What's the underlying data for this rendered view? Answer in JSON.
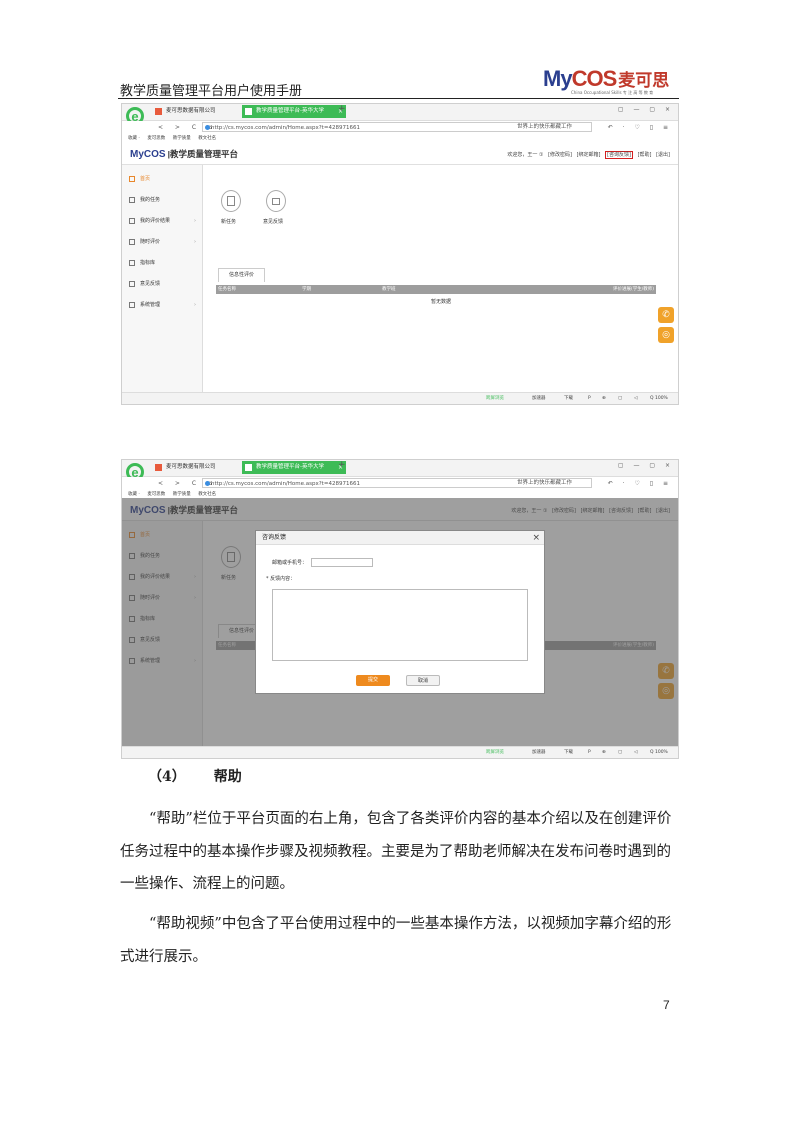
{
  "header": {
    "doc_title": "教学质量管理平台用户使用手册",
    "logo_brand_a": "My",
    "logo_brand_b": "COS",
    "logo_cn": "麦可思",
    "logo_sub": "China Occupational Skills  专 注 高 等 教 育"
  },
  "browser": {
    "tab1_label": "麦可思数据有限公司",
    "tab2_label": "教学质量管理平台-英华大学",
    "close_glyph": "×",
    "plus_glyph": "+",
    "window_controls": "▢ — ▢ ×",
    "nav_buttons": "< > C ⌂",
    "url": "http://cs.mycos.com/admin/Home.aspx?t=428971661",
    "search_text": "世界上的快乐都藏工作",
    "addr_controls": "↶ · ♡ ▯ ≡",
    "bookmarks": [
      "收藏 ·",
      "麦可思数",
      "教学质量",
      "教文社名"
    ],
    "ie_letter": "e"
  },
  "app": {
    "logo_brand": "MyCOS",
    "logo_title": "|教学质量管理平台",
    "top_links": [
      "欢迎您，王一 ①",
      "[修改密码]",
      "[绑定邮箱]",
      "[咨询反馈]",
      "[帮助]",
      "[退出]"
    ],
    "sidebar": [
      {
        "label": "首页"
      },
      {
        "label": "我的任务"
      },
      {
        "label": "我的评价结果"
      },
      {
        "label": "随时评价"
      },
      {
        "label": "指标库"
      },
      {
        "label": "意见反馈"
      },
      {
        "label": "系统管理"
      }
    ],
    "arrow_glyph": "›",
    "quick_new_task": "新任务",
    "quick_feedback": "意见反馈",
    "subtab_label": "信息性评价",
    "table_headers": [
      "任务名称",
      "学期",
      "教学班",
      "评价进展(学生/教师)"
    ],
    "no_data": "暂无数据",
    "phone_glyph": "✆",
    "chat_glyph": "◎",
    "status_items": [
      "跨屏浏览",
      "加速器",
      "下载",
      "P",
      "⊕",
      "▢",
      "◁",
      "Q 100%"
    ]
  },
  "dialog": {
    "title": "咨询反馈",
    "close": "×",
    "email_label": "邮箱或手机号：",
    "content_label": "* 反馈内容：",
    "submit": "提交",
    "cancel": "取消"
  },
  "body": {
    "section_num": "（4）",
    "section_title": "帮助",
    "para1": "“帮助”栏位于平台页面的右上角，包含了各类评价内容的基本介绍以及在创建评价任务过程中的基本操作步骤及视频教程。主要是为了帮助老师解决在发布问卷时遇到的一些操作、流程上的问题。",
    "para2": "“帮助视频”中包含了平台使用过程中的一些基本操作方法，以视频加字幕介绍的形式进行展示。",
    "page_number": "7"
  }
}
